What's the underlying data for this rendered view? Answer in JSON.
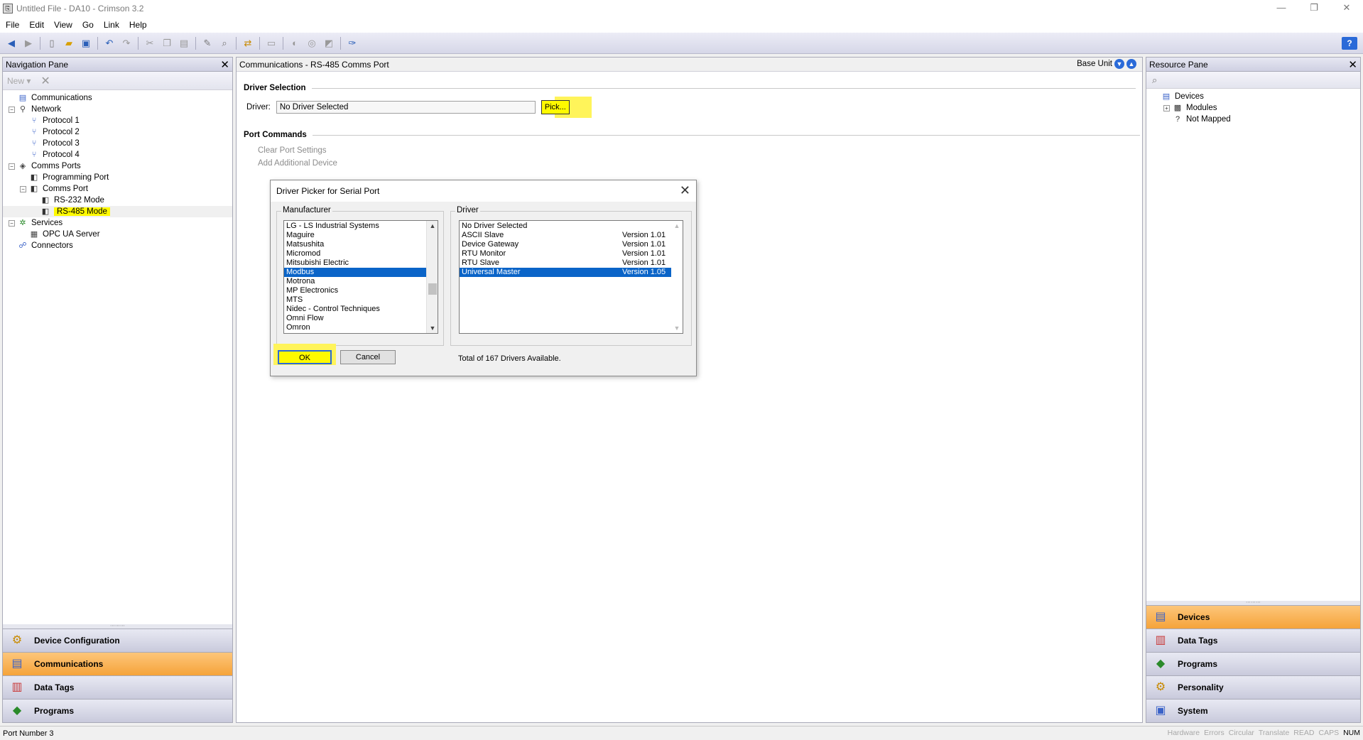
{
  "window": {
    "title": "Untitled File - DA10 - Crimson 3.2",
    "controls": [
      "—",
      "❐",
      "✕"
    ]
  },
  "menu": [
    "File",
    "Edit",
    "View",
    "Go",
    "Link",
    "Help"
  ],
  "nav_pane": {
    "title": "Navigation Pane",
    "new_label": "New ▾",
    "tree": [
      {
        "label": "Communications",
        "level": 0,
        "icon": "communications-icon",
        "exp": ""
      },
      {
        "label": "Network",
        "level": 0,
        "icon": "network-icon",
        "exp": "−"
      },
      {
        "label": "Protocol 1",
        "level": 1,
        "icon": "protocol-icon",
        "exp": ""
      },
      {
        "label": "Protocol 2",
        "level": 1,
        "icon": "protocol-icon",
        "exp": ""
      },
      {
        "label": "Protocol 3",
        "level": 1,
        "icon": "protocol-icon",
        "exp": ""
      },
      {
        "label": "Protocol 4",
        "level": 1,
        "icon": "protocol-icon",
        "exp": ""
      },
      {
        "label": "Comms Ports",
        "level": 0,
        "icon": "ports-icon",
        "exp": "−"
      },
      {
        "label": "Programming Port",
        "level": 1,
        "icon": "port-icon",
        "exp": ""
      },
      {
        "label": "Comms Port",
        "level": 1,
        "icon": "port-icon",
        "exp": "−"
      },
      {
        "label": "RS-232 Mode",
        "level": 2,
        "icon": "port-icon",
        "exp": ""
      },
      {
        "label": "RS-485 Mode",
        "level": 2,
        "icon": "port-icon",
        "exp": "",
        "selected": true
      },
      {
        "label": "Services",
        "level": 0,
        "icon": "services-icon",
        "exp": "−"
      },
      {
        "label": "OPC UA Server",
        "level": 1,
        "icon": "server-icon",
        "exp": ""
      },
      {
        "label": "Connectors",
        "level": 0,
        "icon": "connectors-icon",
        "exp": ""
      }
    ],
    "buttons": [
      {
        "label": "Device Configuration",
        "icon": "gear-icon",
        "active": false
      },
      {
        "label": "Communications",
        "icon": "communications-icon",
        "active": true
      },
      {
        "label": "Data Tags",
        "icon": "data-tags-icon",
        "active": false
      },
      {
        "label": "Programs",
        "icon": "programs-icon",
        "active": false
      }
    ]
  },
  "center": {
    "title": "Communications - RS-485 Comms Port",
    "base_unit": "Base Unit",
    "driver_selection": "Driver Selection",
    "driver_label": "Driver:",
    "driver_value": "No Driver Selected",
    "pick_label": "Pick...",
    "port_commands": "Port Commands",
    "commands": [
      "Clear Port Settings",
      "Add Additional Device"
    ]
  },
  "dialog": {
    "title": "Driver Picker for Serial Port",
    "manufacturer_label": "Manufacturer",
    "driver_label": "Driver",
    "manufacturers": [
      "LG - LS Industrial Systems",
      "Maguire",
      "Matsushita",
      "Micromod",
      "Mitsubishi Electric",
      "Modbus",
      "Motrona",
      "MP Electronics",
      "MTS",
      "Nidec - Control Techniques",
      "Omni Flow",
      "Omron"
    ],
    "selected_manufacturer": "Modbus",
    "drivers": [
      {
        "name": "No Driver Selected",
        "version": ""
      },
      {
        "name": "ASCII Slave",
        "version": "Version 1.01"
      },
      {
        "name": "Device Gateway",
        "version": "Version 1.01"
      },
      {
        "name": "RTU Monitor",
        "version": "Version 1.01"
      },
      {
        "name": "RTU Slave",
        "version": "Version 1.01"
      },
      {
        "name": "Universal Master",
        "version": "Version 1.05"
      }
    ],
    "selected_driver": "Universal Master",
    "ok_label": "OK",
    "cancel_label": "Cancel",
    "total_text": "Total of 167 Drivers Available."
  },
  "resource_pane": {
    "title": "Resource Pane",
    "tree": [
      {
        "label": "Devices",
        "level": 0,
        "icon": "devices-icon",
        "exp": ""
      },
      {
        "label": "Modules",
        "level": 1,
        "icon": "modules-icon",
        "exp": "+"
      },
      {
        "label": "Not Mapped",
        "level": 1,
        "icon": "help-icon",
        "exp": ""
      }
    ],
    "buttons": [
      {
        "label": "Devices",
        "icon": "devices-icon",
        "active": true
      },
      {
        "label": "Data Tags",
        "icon": "data-tags-icon",
        "active": false
      },
      {
        "label": "Programs",
        "icon": "programs-icon",
        "active": false
      },
      {
        "label": "Personality",
        "icon": "gear-icon",
        "active": false
      },
      {
        "label": "System",
        "icon": "system-icon",
        "active": false
      }
    ]
  },
  "status": {
    "left": "Port Number 3",
    "indicators": [
      {
        "label": "Hardware",
        "on": false
      },
      {
        "label": "Errors",
        "on": false
      },
      {
        "label": "Circular",
        "on": false
      },
      {
        "label": "Translate",
        "on": false
      },
      {
        "label": "READ",
        "on": false
      },
      {
        "label": "CAPS",
        "on": false
      },
      {
        "label": "NUM",
        "on": true
      }
    ]
  }
}
